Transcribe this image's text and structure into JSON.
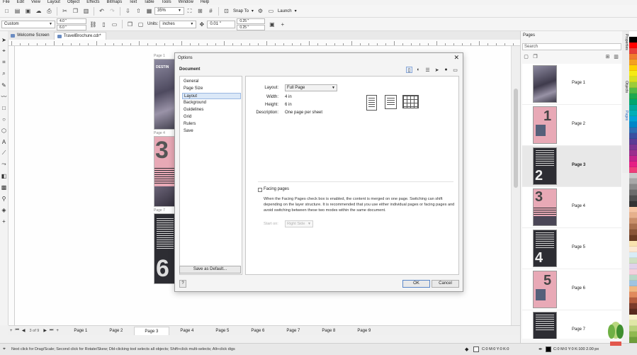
{
  "menu": [
    "File",
    "Edit",
    "View",
    "Layout",
    "Object",
    "Effects",
    "Bitmaps",
    "Text",
    "Table",
    "Tools",
    "Window",
    "Help"
  ],
  "toolbar1": {
    "zoom": "35%",
    "snap_label": "Snap To",
    "launch_label": "Launch"
  },
  "toolbar2": {
    "preset": "Custom",
    "width": "4.0 \"",
    "height": "6.0 \"",
    "units_label": "Units:",
    "units_value": "inches",
    "nudge": "0.01 \"",
    "dup_x": "0.25 \"",
    "dup_y": "0.25 \""
  },
  "doc_tabs": [
    {
      "label": "Welcome Screen"
    },
    {
      "label": "TravelBrochure.cdr*"
    }
  ],
  "canvas": {
    "page_labels": [
      "Page 1",
      "Page 4",
      "Page 7"
    ],
    "title_fragment": "DESTIN"
  },
  "dialog": {
    "title": "Options",
    "section": "Document",
    "tree": [
      "General",
      "Page Size",
      "Layout",
      "Background",
      "Guidelines",
      "Grid",
      "Rulers",
      "Save"
    ],
    "save_default": "Save as Default...",
    "layout_label": "Layout:",
    "layout_value": "Full Page",
    "width_label": "Width:",
    "width_value": "4 in",
    "height_label": "Height:",
    "height_value": "6 in",
    "desc_label": "Description:",
    "desc_value": "One page per sheet",
    "facing_label": "Facing pages",
    "facing_text": "When the Facing Pages check box is enabled, the content is merged on one page. Switching can shift depending on the layer structure. It is recommended that you use either individual pages or facing pages and avoid switching between these two modes within the same document.",
    "start_on_label": "Start on:",
    "start_on_value": "Right Side",
    "help": "?",
    "ok": "OK",
    "cancel": "Cancel"
  },
  "docker": {
    "title": "Pages",
    "search_placeholder": "Search",
    "pages": [
      {
        "name": "Page 1",
        "num": ""
      },
      {
        "name": "Page 2",
        "num": "1"
      },
      {
        "name": "Page 3",
        "num": "2"
      },
      {
        "name": "Page 4",
        "num": "3"
      },
      {
        "name": "Page 5",
        "num": "4"
      },
      {
        "name": "Page 6",
        "num": "5"
      },
      {
        "name": "Page 7",
        "num": ""
      }
    ],
    "vtabs": [
      "Properties",
      "Objects",
      "Pages"
    ]
  },
  "pagebar": {
    "count": "3 of 9",
    "tabs": [
      "Page 1",
      "Page 2",
      "Page 3",
      "Page 4",
      "Page 5",
      "Page 6",
      "Page 7",
      "Page 8",
      "Page 9"
    ]
  },
  "status": {
    "hint": "Next click for Drag/Scale; Second click for Rotate/Skew; Dbl-clicking tool selects all objects; Shift+click multi-selects; Alt+click digs",
    "fill": "C:0 M:0 Y:0 K:0",
    "outline": "C:0 M:0 Y:0 K:100  2.00 px"
  },
  "colors": {
    "accent": "#5b87c8",
    "pink": "#e8a9b6",
    "dark": "#2d2d33"
  }
}
